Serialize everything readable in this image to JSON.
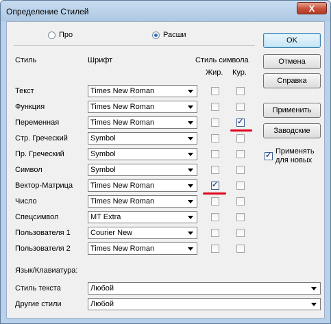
{
  "window": {
    "title": "Определение Стилей",
    "close_label": "X"
  },
  "options": {
    "radio_a_label": "Про",
    "radio_b_label": "Расши",
    "selected": "Расши"
  },
  "headers": {
    "style": "Стиль",
    "font": "Шрифт",
    "char_style": "Стиль символа",
    "bold": "Жир.",
    "italic": "Кур."
  },
  "rows": [
    {
      "label": "Текст",
      "font": "Times New Roman",
      "bold": false,
      "italic": false
    },
    {
      "label": "Функция",
      "font": "Times New Roman",
      "bold": false,
      "italic": false
    },
    {
      "label": "Переменная",
      "font": "Times New Roman",
      "bold": false,
      "italic": true
    },
    {
      "label": "Стр. Греческий",
      "font": "Symbol",
      "bold": false,
      "italic": false
    },
    {
      "label": "Пр. Греческий",
      "font": "Symbol",
      "bold": false,
      "italic": false
    },
    {
      "label": "Символ",
      "font": "Symbol",
      "bold": false,
      "italic": false
    },
    {
      "label": "Вектор-Матрица",
      "font": "Times New Roman",
      "bold": true,
      "italic": false
    },
    {
      "label": "Число",
      "font": "Times New Roman",
      "bold": false,
      "italic": false
    },
    {
      "label": "Спецсимвол",
      "font": "MT Extra",
      "bold": false,
      "italic": false
    },
    {
      "label": "Пользователя 1",
      "font": "Courier New",
      "bold": false,
      "italic": false
    },
    {
      "label": "Пользователя 2",
      "font": "Times New Roman",
      "bold": false,
      "italic": false
    }
  ],
  "language": {
    "section_label": "Язык/Клавиатура:",
    "text_style_label": "Стиль текста",
    "text_style_value": "Любой",
    "other_styles_label": "Другие стили",
    "other_styles_value": "Любой"
  },
  "buttons": {
    "ok": "OK",
    "cancel": "Отмена",
    "help": "Справка",
    "apply": "Применить",
    "factory": "Заводские"
  },
  "apply_new": {
    "label_line1": "Применять",
    "label_line2": "для новых",
    "checked": true
  },
  "colors": {
    "highlight_underline": "#e0001a",
    "frame": "#b9d1ea"
  }
}
